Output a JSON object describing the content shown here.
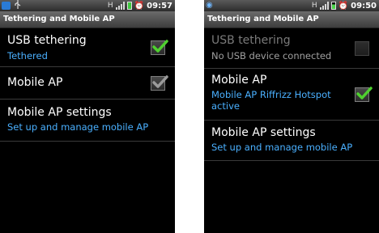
{
  "screens": [
    {
      "status": {
        "time": "09:57"
      },
      "title": "Tethering and Mobile AP",
      "items": [
        {
          "title": "USB tethering",
          "summary": "Tethered",
          "checked": true,
          "enabled": true
        },
        {
          "title": "Mobile AP",
          "summary": "",
          "checked": true,
          "enabled": true,
          "check_color": "grey"
        },
        {
          "title": "Mobile AP settings",
          "summary": "Set up and manage mobile AP"
        }
      ]
    },
    {
      "status": {
        "time": "09:50"
      },
      "title": "Tethering and Mobile AP",
      "items": [
        {
          "title": "USB tethering",
          "summary": "No USB device connected",
          "checked": false,
          "enabled": false
        },
        {
          "title": "Mobile AP",
          "summary_line1": "Mobile AP Riffrizz Hotspot",
          "summary_line2": "active",
          "checked": true,
          "enabled": true
        },
        {
          "title": "Mobile AP settings",
          "summary": "Set up and manage mobile AP"
        }
      ]
    }
  ],
  "colors": {
    "summary": "#4ab0ff",
    "check_green": "#4fd02f",
    "check_grey": "#9a9a9a"
  },
  "icons": [
    "sim-toolkit-icon",
    "usb-icon",
    "wifi-hotspot-icon",
    "signal-icon",
    "battery-icon",
    "alarm-icon",
    "checkmark-icon"
  ]
}
